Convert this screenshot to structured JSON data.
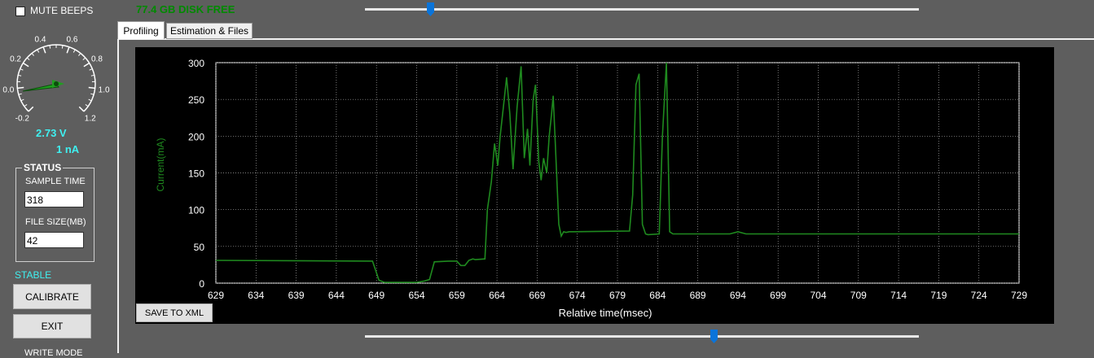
{
  "options": {
    "mute_label": "MUTE BEEPS",
    "mute_checked": false
  },
  "disk": {
    "free_text": "77.4 GB DISK FREE"
  },
  "gauge": {
    "ticks": [
      "-0.2",
      "0.0",
      "0.2",
      "0.4",
      "0.6",
      "0.8",
      "1.0",
      "1.2"
    ],
    "voltage_text": "2.73 V",
    "current_text": "1 nA"
  },
  "status": {
    "title": "STATUS",
    "sample_time_label": "SAMPLE TIME",
    "sample_time_value": "318",
    "file_size_label": "FILE SIZE(MB)",
    "file_size_value": "42"
  },
  "state_text": "STABLE",
  "buttons": {
    "calibrate": "CALIBRATE",
    "exit": "EXIT",
    "save": "SAVE TO XML"
  },
  "write_mode_label": "WRITE MODE",
  "tabs": [
    {
      "label": "Profiling",
      "active": true
    },
    {
      "label": "Estimation & Files",
      "active": false
    }
  ],
  "sliders": {
    "top_position": 0.118,
    "bottom_position": 0.63
  },
  "colors": {
    "trace": "#1f8a1f",
    "accent_text": "#3ff0f0",
    "disk_text": "#008a00",
    "slider_thumb": "#0a74da"
  },
  "chart_data": {
    "type": "line",
    "title": "",
    "xlabel": "Relative time(msec)",
    "ylabel": "Current(mA)",
    "xlim": [
      629,
      729
    ],
    "ylim": [
      0,
      300
    ],
    "xticks": [
      629,
      634,
      639,
      644,
      649,
      654,
      659,
      664,
      669,
      674,
      679,
      684,
      689,
      694,
      699,
      704,
      709,
      714,
      719,
      724,
      729
    ],
    "yticks": [
      0,
      50,
      100,
      150,
      200,
      250,
      300
    ],
    "grid": true,
    "series": [
      {
        "x": [
          629,
          648.5,
          649.3,
          650,
          654,
          655,
          655.6,
          656.2,
          658,
          659,
          659.5,
          660,
          660.5,
          661,
          661.3,
          662.5,
          662.8,
          663.3,
          663.7,
          664.1,
          664.4,
          664.8,
          665.2,
          665.6,
          666,
          666.5,
          667,
          667.4,
          667.8,
          668.1,
          668.5,
          668.8,
          669.2,
          669.5,
          669.8,
          670.2,
          670.5,
          670.8,
          671,
          671.3,
          671.7,
          672,
          672.3,
          672.6,
          673,
          673.5,
          680.5,
          680.9,
          681.3,
          681.7,
          682.1,
          682.5,
          682.8,
          684.2,
          684.6,
          685.1,
          685.5,
          685.9,
          686.3,
          693,
          694,
          695,
          729
        ],
        "y": [
          31,
          30,
          4,
          1,
          1,
          3,
          5,
          29,
          30,
          30,
          24,
          24,
          31,
          33,
          32,
          33,
          100,
          138,
          190,
          160,
          200,
          240,
          280,
          230,
          155,
          240,
          295,
          170,
          210,
          160,
          250,
          270,
          165,
          140,
          170,
          150,
          200,
          230,
          255,
          180,
          80,
          64,
          70,
          69,
          70,
          70,
          71,
          120,
          270,
          285,
          80,
          67,
          66,
          67,
          200,
          300,
          70,
          67,
          67,
          67,
          70,
          67,
          67
        ]
      }
    ]
  }
}
